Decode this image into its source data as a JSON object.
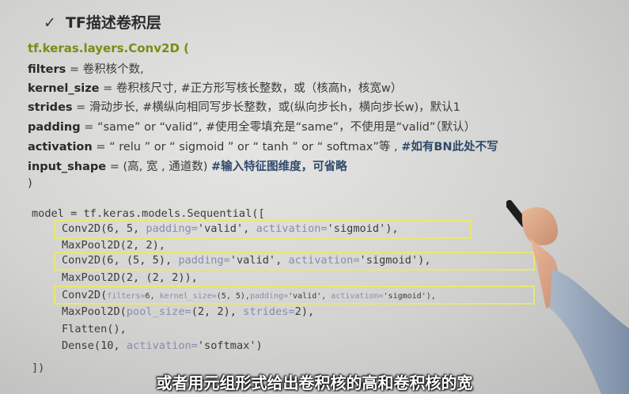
{
  "title": {
    "check": "✓",
    "text": "TF描述卷积层"
  },
  "func": "tf.keras.layers.Conv2D (",
  "params": [
    {
      "key": "filters",
      "rest": " = 卷积核个数,",
      "note": ""
    },
    {
      "key": "kernel_size",
      "rest": " = 卷积核尺寸, #正方形写核长整数，或（核高h，核宽w）",
      "note": ""
    },
    {
      "key": "strides",
      "rest": " = 滑动步长, #横纵向相同写步长整数，或(纵向步长h，横向步长w)，默认1",
      "note": ""
    },
    {
      "key": "padding",
      "rest": " = “same” or “valid”, #使用全零填充是“same”，不使用是“valid”（默认）",
      "note": ""
    },
    {
      "key": "activation",
      "rest": " = “ relu ” or “ sigmoid ” or “ tanh ” or “ softmax”等 , ",
      "note": "#如有BN此处不写"
    },
    {
      "key": "input_shape",
      "rest": " = (高, 宽 , 通道数)      ",
      "note": "#输入特征图维度，可省略"
    }
  ],
  "close_paren": ")",
  "code": {
    "l1": "model = tf.keras.models.Sequential([",
    "l2": [
      "Conv2D(6, 5, ",
      "padding=",
      "'valid', ",
      "activation=",
      "'sigmoid'),"
    ],
    "l3": [
      "MaxPool2D(2, 2),"
    ],
    "l4": [
      "Conv2D(6, (5, 5), ",
      "padding=",
      "'valid', ",
      "activation=",
      "'sigmoid'),"
    ],
    "l5": [
      "MaxPool2D(2, (2, 2)),"
    ],
    "l6": [
      "Conv2D(",
      "filters=",
      "6, ",
      "kernel_size=",
      "(5, 5),",
      "padding=",
      "'valid', ",
      "activation=",
      "'sigmoid'),"
    ],
    "l7": [
      "MaxPool2D(",
      "pool_size=",
      "(2, 2), ",
      "strides=",
      "2),"
    ],
    "l8": [
      "Flatten(),"
    ],
    "l9": [
      "Dense(10, ",
      "activation=",
      "'softmax')"
    ],
    "l10": "])"
  },
  "subtitle": "或者用元组形式给出卷积核的高和卷积核的宽",
  "colors": {
    "func": "#7a8c12",
    "box": "#e8e870",
    "keyword": "#8a8ab0"
  }
}
